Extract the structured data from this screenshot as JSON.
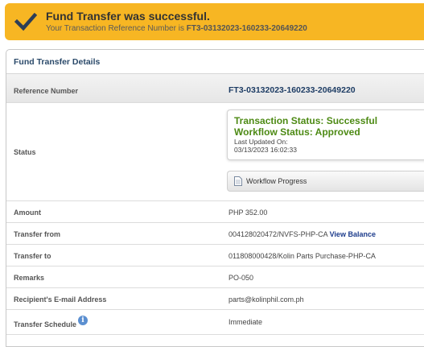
{
  "banner": {
    "title": "Fund Transfer was successful.",
    "subtitle_prefix": "Your Transaction Reference Number is",
    "reference": "FT3-03132023-160233-20649220",
    "icon": "check-icon",
    "color": "#f7b623"
  },
  "panel": {
    "title": "Fund Transfer Details"
  },
  "details": {
    "reference_label": "Reference Number",
    "reference_value": "FT3-03132023-160233-20649220",
    "status_label": "Status",
    "transaction_status": "Transaction Status: Successful",
    "workflow_status": "Workflow Status: Approved",
    "last_updated_label": "Last Updated On:",
    "last_updated_value": "03/13/2023 16:02:33",
    "workflow_button": "Workflow Progress",
    "amount_label": "Amount",
    "amount_value": "PHP 352.00",
    "transfer_from_label": "Transfer from",
    "transfer_from_value": "004128020472/NVFS-PHP-CA",
    "view_balance": "View Balance",
    "transfer_to_label": "Transfer to",
    "transfer_to_value": "011808000428/Kolin Parts Purchase-PHP-CA",
    "remarks_label": "Remarks",
    "remarks_value": "PO-050",
    "email_label": "Recipient's E-mail Address",
    "email_value": "parts@kolinphil.com.ph",
    "schedule_label": "Transfer Schedule",
    "schedule_value": "Immediate"
  },
  "colors": {
    "status_green": "#4d8a14",
    "heading_navy": "#1d3c64",
    "link_blue": "#1d3c8c"
  }
}
